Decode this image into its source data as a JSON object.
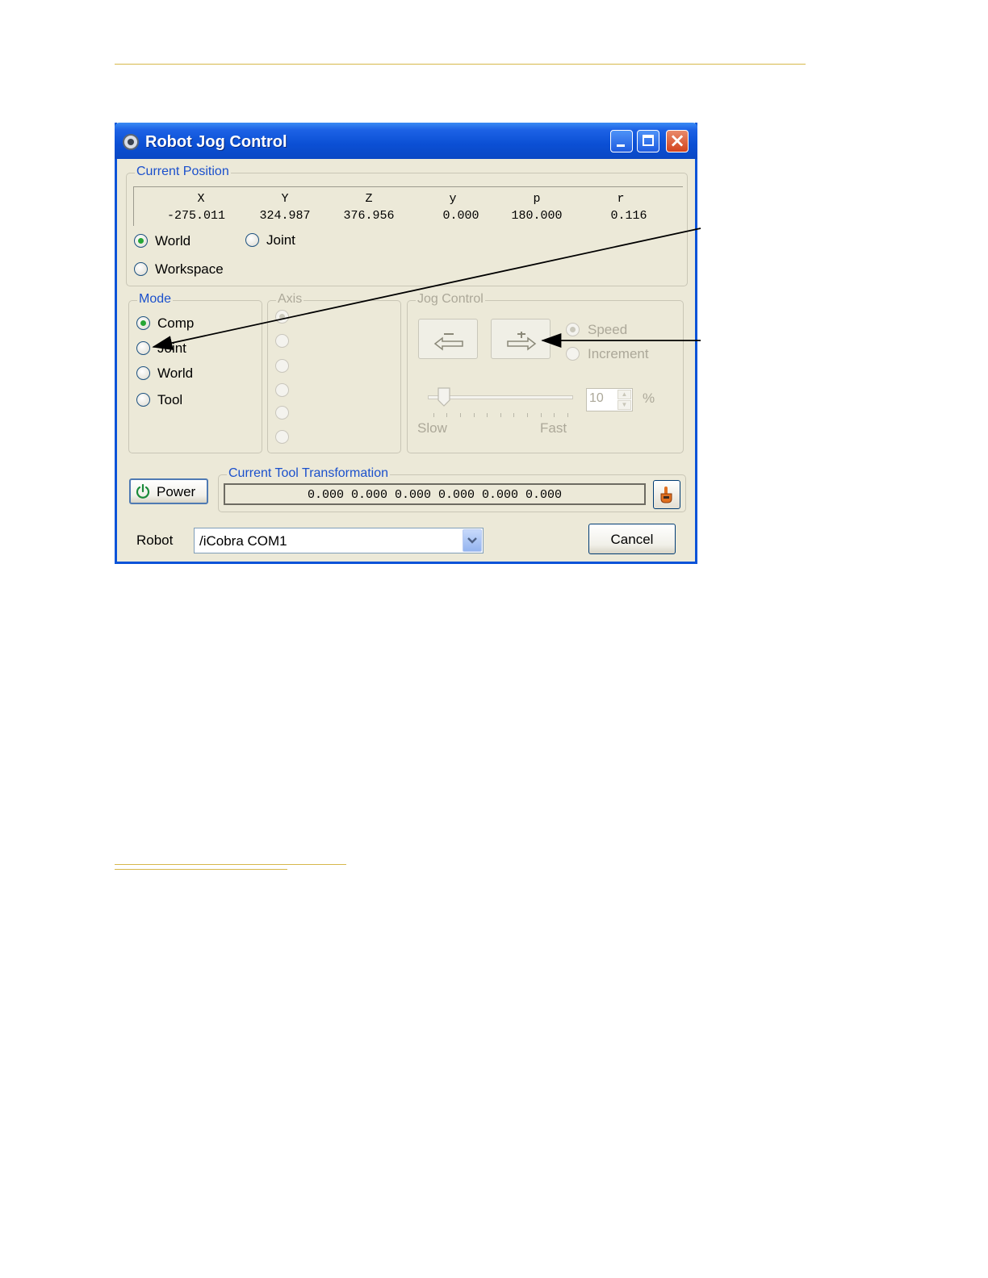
{
  "window": {
    "title": "Robot Jog Control"
  },
  "current_position": {
    "legend": "Current Position",
    "headers": [
      "X",
      "Y",
      "Z",
      "y",
      "p",
      "r"
    ],
    "values": [
      "-275.011",
      "324.987",
      "376.956",
      "0.000",
      "180.000",
      "0.116"
    ],
    "frames": [
      {
        "label": "World",
        "checked": true
      },
      {
        "label": "Joint",
        "checked": false
      },
      {
        "label": "Workspace",
        "checked": false
      }
    ]
  },
  "mode": {
    "legend": "Mode",
    "options": [
      {
        "label": "Comp",
        "checked": true
      },
      {
        "label": "Joint",
        "checked": false
      },
      {
        "label": "World",
        "checked": false
      },
      {
        "label": "Tool",
        "checked": false
      }
    ]
  },
  "axis": {
    "legend": "Axis",
    "enabled": false
  },
  "jog_control": {
    "legend": "Jog Control",
    "enabled": false,
    "options": [
      {
        "label": "Speed",
        "checked": true
      },
      {
        "label": "Increment",
        "checked": false
      }
    ],
    "slow_label": "Slow",
    "fast_label": "Fast",
    "speed_value": "10",
    "unit": "%"
  },
  "power_button": {
    "label": "Power"
  },
  "tool_transformation": {
    "legend": "Current Tool Transformation",
    "value": "0.000 0.000 0.000 0.000 0.000 0.000"
  },
  "robot": {
    "label": "Robot",
    "selected": "/iCobra COM1"
  },
  "cancel_button": {
    "label": "Cancel"
  },
  "colors": {
    "accent_rule": "#d7b84b",
    "titlebar": "#0a53d8",
    "legend_text": "#1b50cc",
    "window_face": "#ece9d8"
  }
}
